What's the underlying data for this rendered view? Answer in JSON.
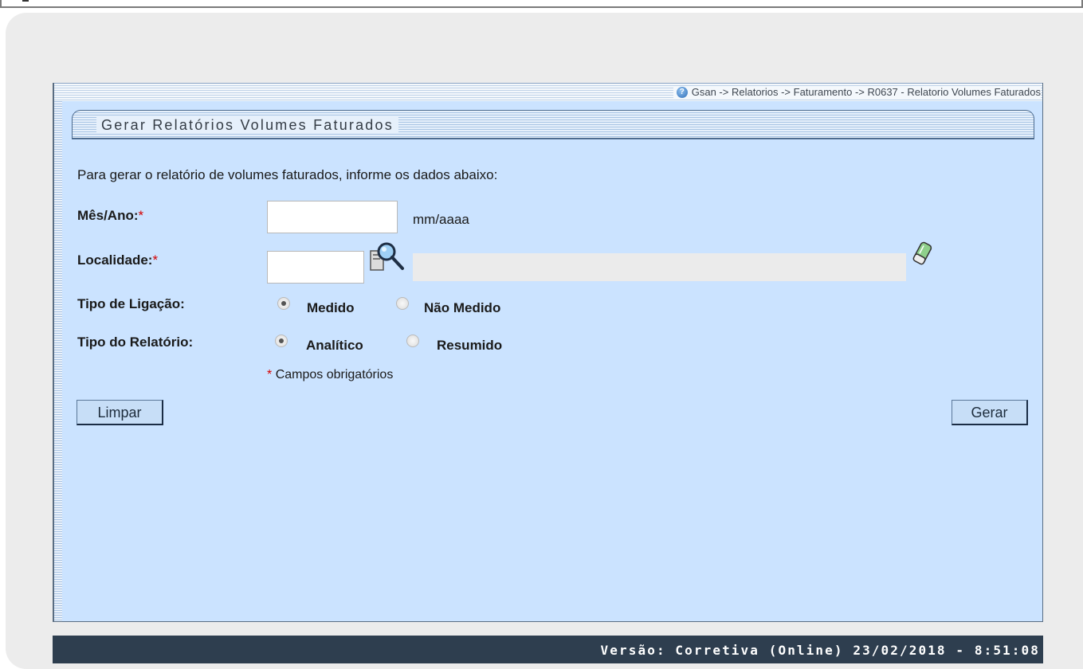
{
  "breadcrumb": "Gsan -> Relatorios -> Faturamento -> R0637 - Relatorio Volumes Faturados",
  "page_title": "Gerar Relatórios Volumes Faturados",
  "instructions": "Para gerar o relatório de volumes faturados, informe os dados abaixo:",
  "form": {
    "mes_ano": {
      "label": "Mês/Ano:",
      "required_mark": "*",
      "value": "",
      "hint": "mm/aaaa"
    },
    "localidade": {
      "label": "Localidade:",
      "required_mark": "*",
      "code_value": "",
      "description_value": ""
    },
    "tipo_ligacao": {
      "label": "Tipo de Ligação:",
      "options": [
        "Medido",
        "Não Medido"
      ],
      "selected": "Medido"
    },
    "tipo_relatorio": {
      "label": "Tipo do Relatório:",
      "options": [
        "Analítico",
        "Resumido"
      ],
      "selected": "Analítico"
    },
    "required_note": {
      "mark": "*",
      "text": "Campos obrigatórios"
    }
  },
  "buttons": {
    "clear": "Limpar",
    "generate": "Gerar"
  },
  "footer": "Versão: Corretiva (Online) 23/02/2018 - 8:51:08",
  "icons": {
    "help": "help-icon",
    "search": "magnifier-search-icon",
    "erase": "eraser-icon"
  },
  "colors": {
    "panel_bg": "#cbe3ff",
    "footer_bg": "#2e3e4f",
    "required": "#d60000"
  }
}
